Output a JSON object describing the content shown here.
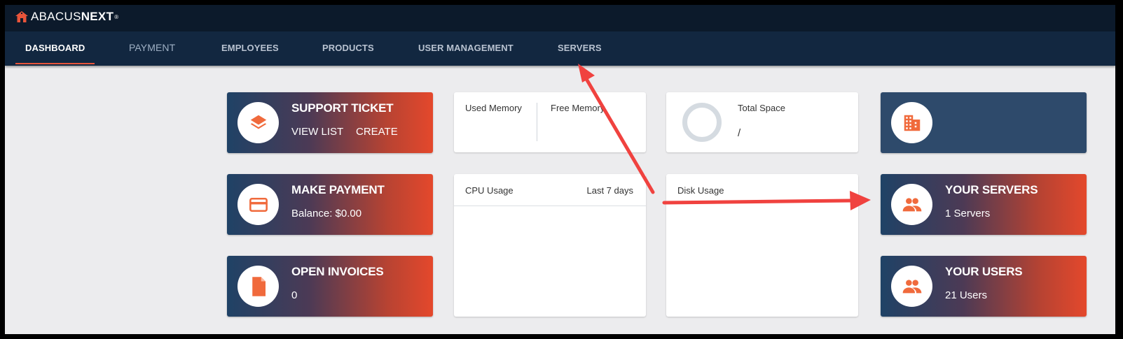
{
  "brand": {
    "name_light": "ABACUS",
    "name_bold": "NEXT",
    "trademark": "®"
  },
  "nav": {
    "items": [
      {
        "label": "DASHBOARD"
      },
      {
        "label": "PAYMENT"
      },
      {
        "label": "EMPLOYEES"
      },
      {
        "label": "PRODUCTS"
      },
      {
        "label": "USER MANAGEMENT"
      },
      {
        "label": "SERVERS"
      }
    ]
  },
  "cards": {
    "support": {
      "title": "SUPPORT TICKET",
      "view_list": "VIEW LIST",
      "create": "CREATE"
    },
    "payment": {
      "title": "MAKE PAYMENT",
      "balance": "Balance: $0.00"
    },
    "invoices": {
      "title": "OPEN INVOICES",
      "count": "0"
    },
    "memory": {
      "used": "Used Memory",
      "free": "Free Memory"
    },
    "space": {
      "label": "Total Space",
      "value": "/"
    },
    "cpu": {
      "label": "CPU Usage",
      "range": "Last 7 days"
    },
    "disk": {
      "label": "Disk Usage"
    },
    "servers": {
      "title": "YOUR SERVERS",
      "count": "1 Servers"
    },
    "users": {
      "title": "YOUR USERS",
      "count": "21 Users"
    }
  },
  "colors": {
    "accent": "#f06a3c",
    "annotation_arrow": "#f0423f",
    "nav_bg": "#122740"
  }
}
